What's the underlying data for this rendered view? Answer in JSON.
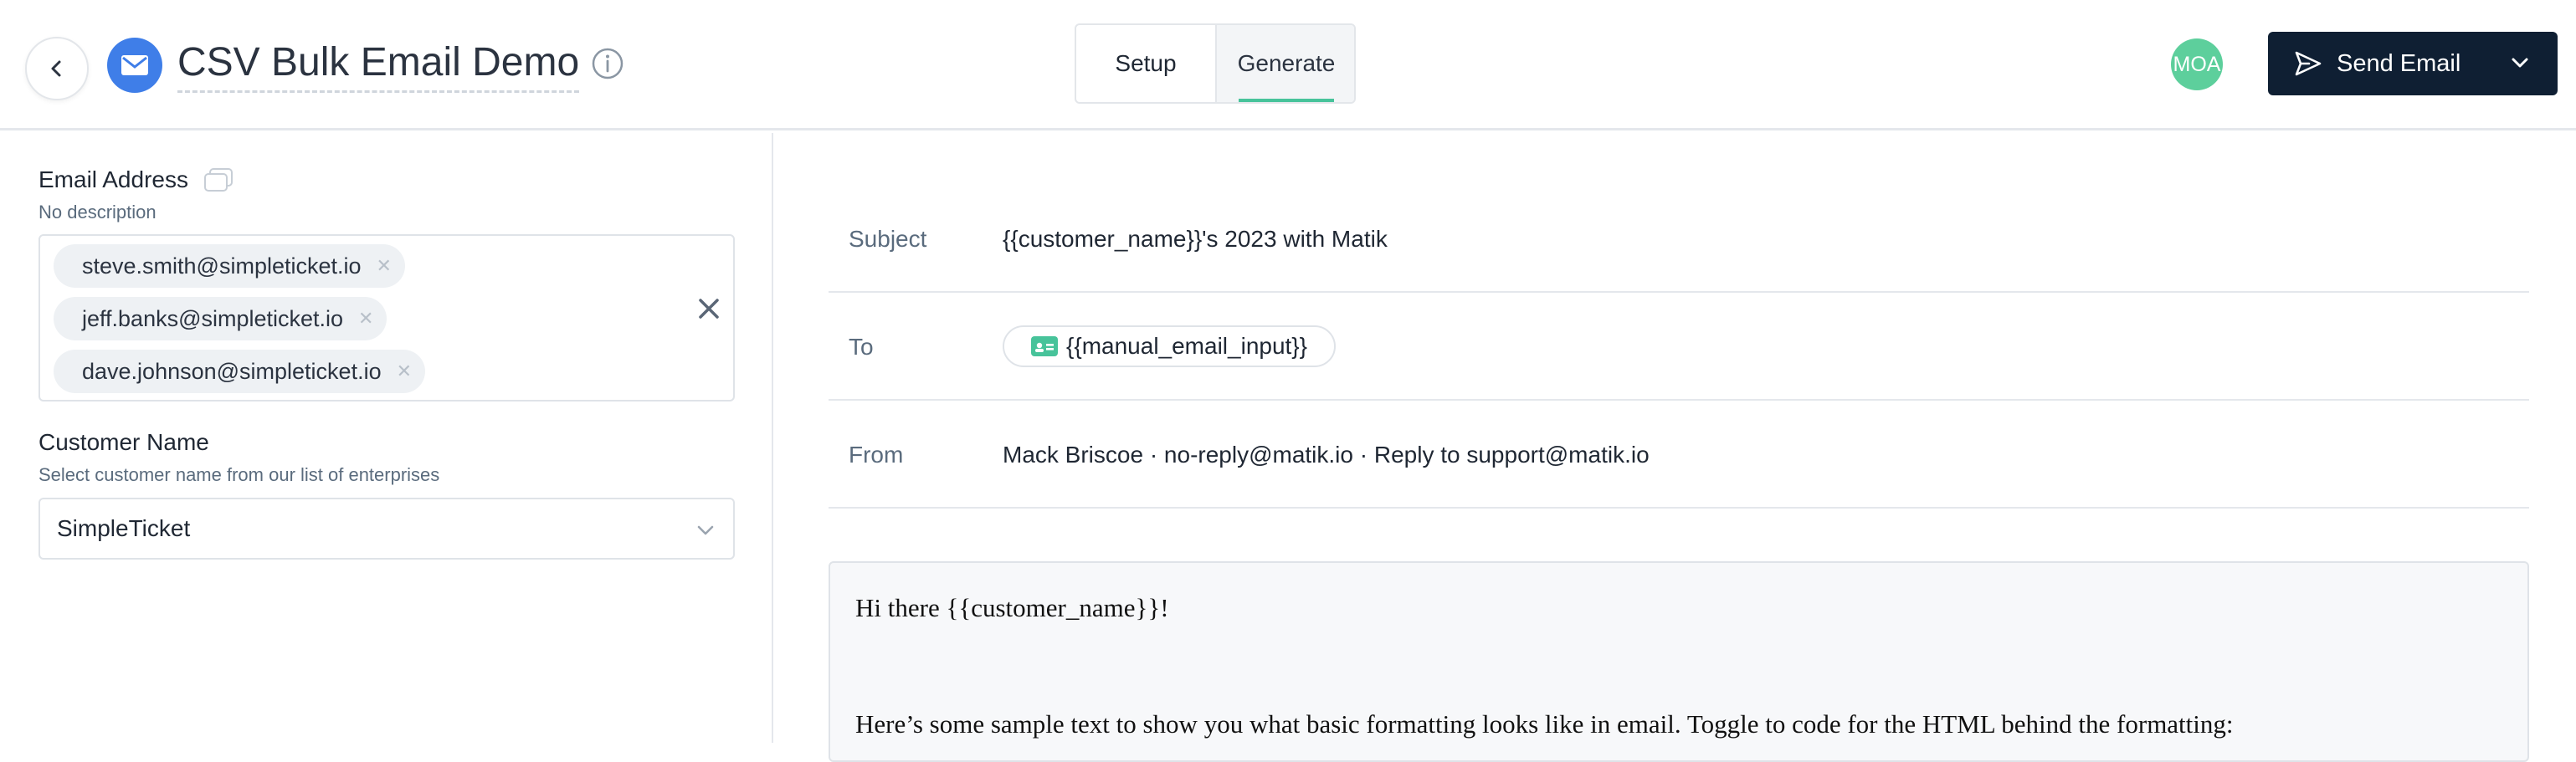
{
  "header": {
    "title": "CSV Bulk Email Demo",
    "tabs": [
      {
        "label": "Setup",
        "active": false
      },
      {
        "label": "Generate",
        "active": true
      }
    ],
    "avatar_initials": "MOA",
    "send_button_label": "Send Email"
  },
  "left_panel": {
    "email_field": {
      "label": "Email Address",
      "description": "No description",
      "chips": [
        "steve.smith@simpleticket.io",
        "jeff.banks@simpleticket.io",
        "dave.johnson@simpleticket.io"
      ]
    },
    "customer_field": {
      "label": "Customer Name",
      "description": "Select customer name from our list of enterprises",
      "selected": "SimpleTicket"
    }
  },
  "email_preview": {
    "subject_label": "Subject",
    "subject_value": "{{customer_name}}'s 2023 with Matik",
    "to_label": "To",
    "to_value": "{{manual_email_input}}",
    "from_label": "From",
    "from_value": "Mack Briscoe · no-reply@matik.io · Reply to support@matik.io",
    "body_lines": [
      "Hi there {{customer_name}}!",
      "Here’s some sample text to show you what basic formatting looks like in email. Toggle to code for the HTML behind the formatting:"
    ]
  },
  "colors": {
    "accent_green": "#47c39a",
    "brand_blue": "#3f7ee8",
    "send_button_bg": "#0f1f33"
  },
  "icons": [
    "back-arrow-icon",
    "mail-icon",
    "info-icon",
    "send-icon",
    "chevron-down-icon",
    "copy-icon",
    "chip-close-icon",
    "clear-icon",
    "contact-card-icon"
  ]
}
